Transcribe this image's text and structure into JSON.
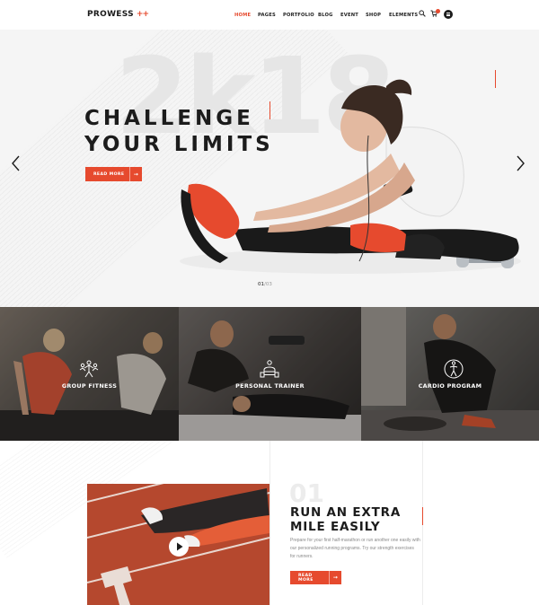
{
  "brand": {
    "name": "PROWESS",
    "mark": "++"
  },
  "nav": {
    "items": [
      {
        "label": "HOME",
        "active": true
      },
      {
        "label": "PAGES",
        "active": false
      },
      {
        "label": "PORTFOLIO",
        "active": false
      },
      {
        "label": "BLOG",
        "active": false
      },
      {
        "label": "EVENT",
        "active": false
      },
      {
        "label": "SHOP",
        "active": false
      },
      {
        "label": "ELEMENTS",
        "active": false
      }
    ],
    "icons": [
      "search-icon",
      "cart-icon",
      "menu-icon"
    ]
  },
  "hero": {
    "watermark": "2k18",
    "title_line1": "CHALLENGE",
    "title_line2": "YOUR LIMITS",
    "button_label": "READ MORE",
    "button_arrow": "→",
    "prev_icon": "chevron-left-icon",
    "next_icon": "chevron-right-icon",
    "counter_current": "01",
    "counter_total": "/03"
  },
  "services": [
    {
      "label": "GROUP FITNESS",
      "icon": "group-fitness-icon"
    },
    {
      "label": "PERSONAL TRAINER",
      "icon": "personal-trainer-icon"
    },
    {
      "label": "CARDIO PROGRAM",
      "icon": "cardio-program-icon"
    }
  ],
  "feature": {
    "number": "01",
    "title_line1": "RUN AN EXTRA",
    "title_line2": "MILE EASILY",
    "description": "Prepare for your first half-marathon or run another one easily with our personalized running programs. Try our strength exercises for runners.",
    "button_label": "READ MORE",
    "button_arrow": "→",
    "play_icon": "play-icon"
  },
  "colors": {
    "accent": "#e64a2e",
    "dark": "#1c1c1c",
    "hero_bg": "#f5f5f5"
  }
}
